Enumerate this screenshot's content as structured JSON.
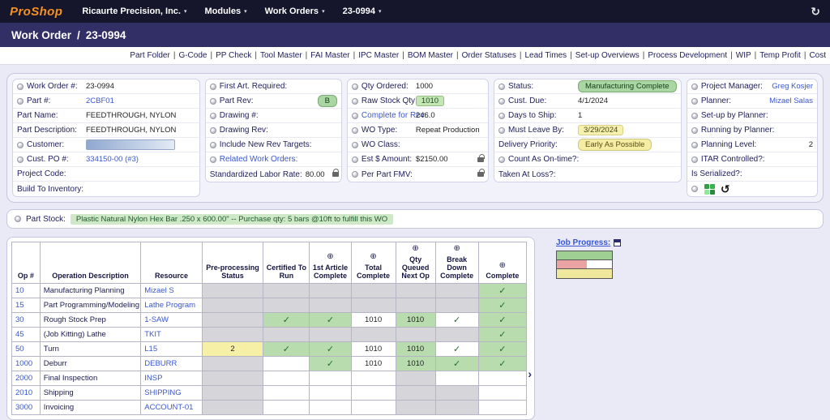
{
  "icons": {
    "caret_down": "▾",
    "refresh": "↻",
    "chevron_right": "›",
    "plus": "⊕",
    "check": "✓",
    "history": "↺"
  },
  "colors": {
    "status_green": "#a9d6a2",
    "warning_yellow": "#f4eda2",
    "link_blue": "#3a57d0",
    "logo_orange": "#f5911e",
    "topbar_bg": "#15152c",
    "titlebar_bg": "#322e66"
  },
  "topbar": {
    "logo": "ProShop",
    "menus": [
      {
        "label": "Ricaurte Precision, Inc."
      },
      {
        "label": "Modules"
      },
      {
        "label": "Work Orders"
      },
      {
        "label": "23-0994"
      }
    ]
  },
  "titlebar": {
    "title": "Work Order",
    "separator": "/",
    "number": "23-0994"
  },
  "quicklinks": [
    "Part Folder",
    "G-Code",
    "PP Check",
    "Tool Master",
    "FAI Master",
    "IPC Master",
    "BOM Master",
    "Order Statuses",
    "Lead Times",
    "Set-up Overviews",
    "Process Development",
    "WIP",
    "Temp Profit",
    "Cost"
  ],
  "info_columns": [
    {
      "rows": [
        {
          "dot": true,
          "label": "Work Order #:",
          "value": "23-0994",
          "style": "plain"
        },
        {
          "dot": true,
          "label": "Part #:",
          "value": "2CBF01",
          "style": "link"
        },
        {
          "dot": false,
          "label": "Part Name:",
          "value": "FEEDTHROUGH, NYLON",
          "style": "plain"
        },
        {
          "dot": false,
          "label": "Part Description:",
          "value": "FEEDTHROUGH, NYLON",
          "style": "plain"
        },
        {
          "dot": true,
          "label": "Customer:",
          "value": "",
          "style": "customer-box"
        },
        {
          "dot": true,
          "label": "Cust. PO #:",
          "value": "334150-00 (#3)",
          "style": "link"
        },
        {
          "dot": false,
          "label": "Project Code:",
          "value": "",
          "style": "plain"
        },
        {
          "dot": false,
          "label": "Build To Inventory:",
          "value": "",
          "style": "plain"
        }
      ]
    },
    {
      "rows": [
        {
          "dot": true,
          "label": "First Art. Required:",
          "value": "",
          "style": "plain"
        },
        {
          "dot": true,
          "label": "Part Rev:",
          "value": "B",
          "style": "green-pill"
        },
        {
          "dot": true,
          "label": "Drawing #:",
          "value": "",
          "style": "plain"
        },
        {
          "dot": true,
          "label": "Drawing Rev:",
          "value": "",
          "style": "plain"
        },
        {
          "dot": true,
          "label": "Include New Rev Targets:",
          "value": "",
          "style": "plain"
        },
        {
          "dot": true,
          "label": "Related Work Orders:",
          "value": "",
          "style": "plain",
          "label_link": true
        },
        {
          "dot": false,
          "label": "Standardized Labor Rate:",
          "value": "80.00",
          "style": "plain",
          "lock": true
        }
      ]
    },
    {
      "rows": [
        {
          "dot": true,
          "label": "Qty Ordered:",
          "value": "1000",
          "style": "plain"
        },
        {
          "dot": true,
          "label": "Raw Stock Qty:",
          "value": "1010",
          "style": "green-box"
        },
        {
          "dot": true,
          "label": "Complete for Rev:",
          "value": "246.0",
          "style": "plain",
          "label_link": true
        },
        {
          "dot": true,
          "label": "WO Type:",
          "value": "Repeat Production",
          "style": "plain"
        },
        {
          "dot": true,
          "label": "WO Class:",
          "value": "",
          "style": "plain"
        },
        {
          "dot": true,
          "label": "Est $ Amount:",
          "value": "$2150.00",
          "style": "plain",
          "lock": true
        },
        {
          "dot": true,
          "label": "Per Part FMV:",
          "value": "",
          "style": "plain",
          "lock": true
        }
      ]
    },
    {
      "rows": [
        {
          "dot": true,
          "label": "Status:",
          "value": "Manufacturing Complete",
          "style": "green-pill"
        },
        {
          "dot": true,
          "label": "Cust. Due:",
          "value": "4/1/2024",
          "style": "plain"
        },
        {
          "dot": true,
          "label": "Days to Ship:",
          "value": "1",
          "style": "plain"
        },
        {
          "dot": true,
          "label": "Must Leave By:",
          "value": "3/29/2024",
          "style": "yellow-box"
        },
        {
          "dot": false,
          "label": "Delivery Priority:",
          "value": "Early As Possible",
          "style": "yellow-pill"
        },
        {
          "dot": true,
          "label": "Count As On-time?:",
          "value": "",
          "style": "plain"
        },
        {
          "dot": false,
          "label": "Taken At Loss?:",
          "value": "",
          "style": "plain"
        }
      ]
    },
    {
      "rows": [
        {
          "dot": true,
          "label": "Project Manager:",
          "value": "Greg Kosjer",
          "style": "link"
        },
        {
          "dot": true,
          "label": "Planner:",
          "value": "Mizael Salas",
          "style": "link"
        },
        {
          "dot": true,
          "label": "Set-up by Planner:",
          "value": "",
          "style": "plain"
        },
        {
          "dot": true,
          "label": "Running by Planner:",
          "value": "",
          "style": "plain"
        },
        {
          "dot": true,
          "label": "Planning Level:",
          "value": "2",
          "style": "plain"
        },
        {
          "dot": true,
          "label": "ITAR Controlled?:",
          "value": "",
          "style": "plain"
        },
        {
          "dot": false,
          "label": "Is Serialized?:",
          "value": "",
          "style": "plain"
        },
        {
          "dot": true,
          "label": "",
          "value": "",
          "style": "icons"
        }
      ]
    }
  ],
  "part_stock": {
    "label": "Part Stock:",
    "value": "Plastic Natural Nylon Hex Bar .250 x 600.00\" -- Purchase qty: 5 bars @10ft to fulfill this WO"
  },
  "operations_table": {
    "headers": [
      {
        "label": "Op #",
        "plus": false
      },
      {
        "label": "Operation Description",
        "plus": false
      },
      {
        "label": "Resource",
        "plus": false
      },
      {
        "label": "Pre-processing Status",
        "plus": false
      },
      {
        "label": "Certified To Run",
        "plus": false
      },
      {
        "label": "1st Article Complete",
        "plus": true
      },
      {
        "label": "Total Complete",
        "plus": true
      },
      {
        "label": "Qty Queued Next Op",
        "plus": true
      },
      {
        "label": "Break Down Complete",
        "plus": true
      },
      {
        "label": "Complete",
        "plus": true
      }
    ],
    "rows": [
      {
        "op": "10",
        "desc": "Manufacturing Planning",
        "resource": "Mizael S",
        "cells": [
          {
            "bg": "gray",
            "text": ""
          },
          {
            "bg": "gray",
            "text": ""
          },
          {
            "bg": "gray",
            "text": ""
          },
          {
            "bg": "gray",
            "text": ""
          },
          {
            "bg": "gray",
            "text": ""
          },
          {
            "bg": "gray",
            "text": ""
          },
          {
            "bg": "green",
            "text": "✓"
          }
        ]
      },
      {
        "op": "15",
        "desc": "Part Programming/Modeling",
        "resource": "Lathe Program",
        "cells": [
          {
            "bg": "gray",
            "text": ""
          },
          {
            "bg": "gray",
            "text": ""
          },
          {
            "bg": "gray",
            "text": ""
          },
          {
            "bg": "gray",
            "text": ""
          },
          {
            "bg": "gray",
            "text": ""
          },
          {
            "bg": "gray",
            "text": ""
          },
          {
            "bg": "green",
            "text": "✓"
          }
        ]
      },
      {
        "op": "30",
        "desc": "Rough Stock Prep",
        "resource": "1-SAW",
        "cells": [
          {
            "bg": "gray",
            "text": ""
          },
          {
            "bg": "green",
            "text": "✓"
          },
          {
            "bg": "green",
            "text": "✓"
          },
          {
            "bg": "white",
            "text": "1010"
          },
          {
            "bg": "green",
            "text": "1010"
          },
          {
            "bg": "white",
            "text": "✓"
          },
          {
            "bg": "green",
            "text": "✓"
          }
        ]
      },
      {
        "op": "45",
        "desc": "(Job Kitting) Lathe",
        "resource": "TKIT",
        "cells": [
          {
            "bg": "gray",
            "text": ""
          },
          {
            "bg": "gray",
            "text": ""
          },
          {
            "bg": "gray",
            "text": ""
          },
          {
            "bg": "gray",
            "text": ""
          },
          {
            "bg": "gray",
            "text": ""
          },
          {
            "bg": "gray",
            "text": ""
          },
          {
            "bg": "green",
            "text": "✓"
          }
        ]
      },
      {
        "op": "50",
        "desc": "Turn",
        "resource": "L15",
        "cells": [
          {
            "bg": "yellow",
            "text": "2"
          },
          {
            "bg": "green",
            "text": "✓"
          },
          {
            "bg": "green",
            "text": "✓"
          },
          {
            "bg": "white",
            "text": "1010"
          },
          {
            "bg": "green",
            "text": "1010"
          },
          {
            "bg": "white",
            "text": "✓"
          },
          {
            "bg": "green",
            "text": "✓"
          }
        ]
      },
      {
        "op": "1000",
        "desc": "Deburr",
        "resource": "DEBURR",
        "cells": [
          {
            "bg": "gray",
            "text": ""
          },
          {
            "bg": "white",
            "text": ""
          },
          {
            "bg": "green",
            "text": "✓"
          },
          {
            "bg": "white",
            "text": "1010"
          },
          {
            "bg": "green",
            "text": "1010"
          },
          {
            "bg": "green",
            "text": "✓"
          },
          {
            "bg": "green",
            "text": "✓"
          }
        ]
      },
      {
        "op": "2000",
        "desc": "Final Inspection",
        "resource": "INSP",
        "cells": [
          {
            "bg": "gray",
            "text": ""
          },
          {
            "bg": "white",
            "text": ""
          },
          {
            "bg": "white",
            "text": ""
          },
          {
            "bg": "white",
            "text": ""
          },
          {
            "bg": "gray",
            "text": ""
          },
          {
            "bg": "white",
            "text": ""
          },
          {
            "bg": "white",
            "text": ""
          }
        ]
      },
      {
        "op": "2010",
        "desc": "Shipping",
        "resource": "SHIPPING",
        "cells": [
          {
            "bg": "gray",
            "text": ""
          },
          {
            "bg": "white",
            "text": ""
          },
          {
            "bg": "white",
            "text": ""
          },
          {
            "bg": "white",
            "text": ""
          },
          {
            "bg": "gray",
            "text": ""
          },
          {
            "bg": "gray",
            "text": ""
          },
          {
            "bg": "white",
            "text": ""
          }
        ]
      },
      {
        "op": "3000",
        "desc": "Invoicing",
        "resource": "ACCOUNT-01",
        "cells": [
          {
            "bg": "gray",
            "text": ""
          },
          {
            "bg": "white",
            "text": ""
          },
          {
            "bg": "white",
            "text": ""
          },
          {
            "bg": "white",
            "text": ""
          },
          {
            "bg": "gray",
            "text": ""
          },
          {
            "bg": "gray",
            "text": ""
          },
          {
            "bg": "white",
            "text": ""
          }
        ]
      }
    ]
  },
  "job_progress": {
    "label": "Job Progress:",
    "bars": [
      {
        "segments": [
          {
            "color": "#9fcf92",
            "pct": 100
          }
        ]
      },
      {
        "segments": [
          {
            "color": "#e9a3a3",
            "pct": 55
          },
          {
            "color": "#ffffff",
            "pct": 45
          }
        ]
      },
      {
        "segments": [
          {
            "color": "#efe89c",
            "pct": 100
          }
        ]
      }
    ]
  }
}
